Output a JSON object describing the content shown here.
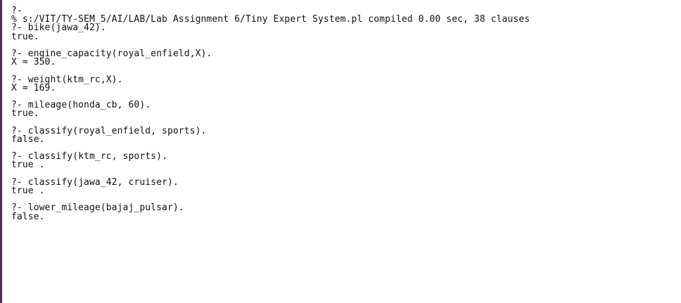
{
  "console": {
    "header_prompt": "?-",
    "compile_message": "% s:/VIT/TY-SEM_5/AI/LAB/Lab Assignment 6/Tiny Expert System.pl compiled 0.00 sec, 38 clauses",
    "entries": [
      {
        "query": "?- bike(jawa_42).",
        "result": "true."
      },
      {
        "query": "?- engine_capacity(royal_enfield,X).",
        "result": "X = 350."
      },
      {
        "query": "?- weight(ktm_rc,X).",
        "result": "X = 169."
      },
      {
        "query": "?- mileage(honda_cb, 60).",
        "result": "true."
      },
      {
        "query": "?- classify(royal_enfield, sports).",
        "result": "false."
      },
      {
        "query": "?- classify(ktm_rc, sports).",
        "result": "true ."
      },
      {
        "query": "?- classify(jawa_42, cruiser).",
        "result": "true ."
      },
      {
        "query": "?- lower_mileage(bajaj_pulsar).",
        "result": "false."
      }
    ]
  }
}
